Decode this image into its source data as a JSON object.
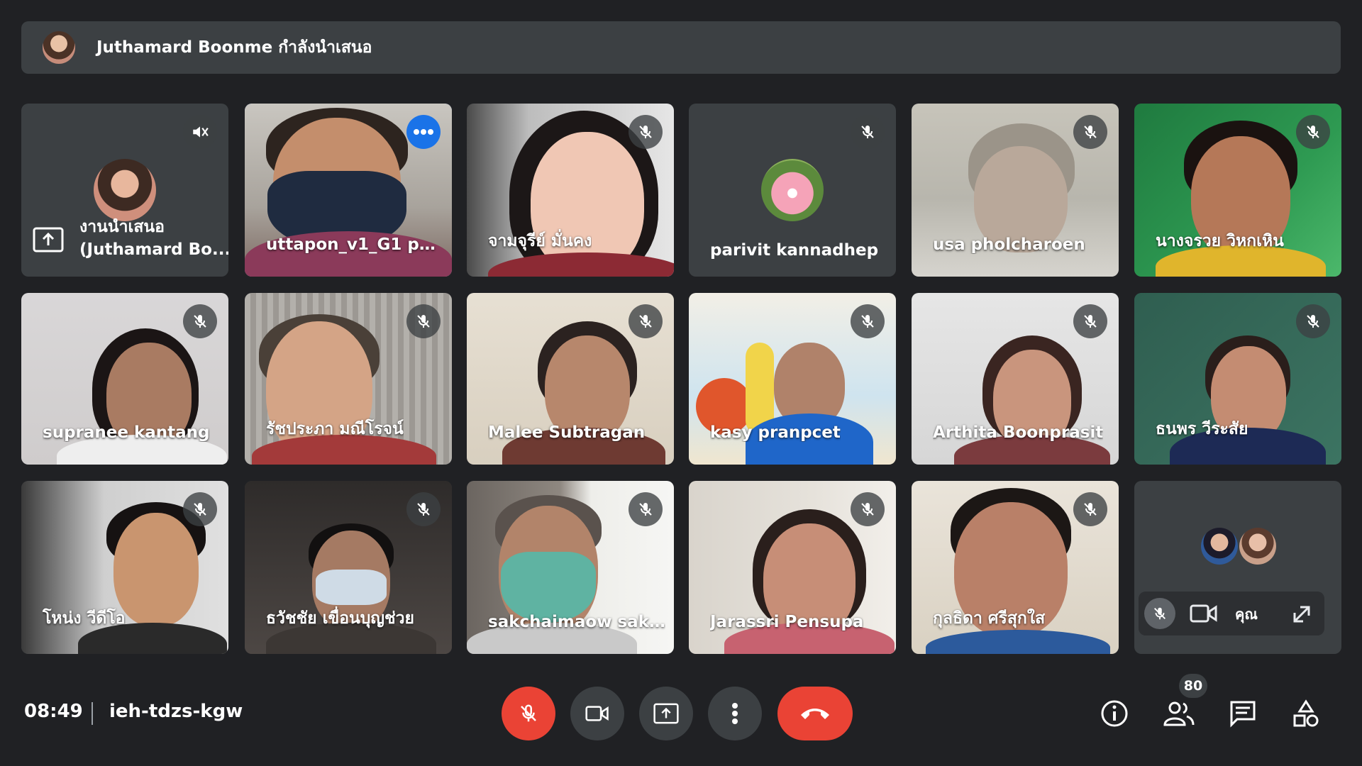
{
  "banner": {
    "text": "Juthamard Boonme กำลังนำเสนอ",
    "avatar_icon": "presenter-avatar-icon"
  },
  "tiles": {
    "presenting": {
      "line1": "งานนำเสนอ",
      "line2": "(Juthamard Bo..."
    },
    "t2": "uttapon_v1_G1 ph...",
    "t3": "จามจุรีย์ มั่นคง",
    "t4": "parivit kannadhep",
    "t5": "usa pholcharoen",
    "t6": "นางจรวย วิหกเหิน",
    "t7": "supranee kantang",
    "t8": "รัชประภา มณีโรจน์",
    "t9": "Malee Subtragan",
    "t10": "kasy pranpcet",
    "t11": "Arthita Boonprasit",
    "t12": "ธนพร วีระสัย",
    "t13": "โหน่ง วีดีโอ",
    "t14": "ธวัชชัย เขื่อนบุญช่วย",
    "t15": "sakchaimaow sakc...",
    "t16": "Jarassri Pensupa",
    "t17": "กุลธิดา ศรีสุกใส",
    "self": {
      "label": "คุณ"
    }
  },
  "controls": {
    "time": "08:49",
    "meeting_code": "ieh-tdzs-kgw",
    "participant_count": "80"
  },
  "colors": {
    "accent": "#8ab4f8",
    "danger": "#ea4335",
    "tile_bg": "#3c4043",
    "page_bg": "#202124"
  }
}
